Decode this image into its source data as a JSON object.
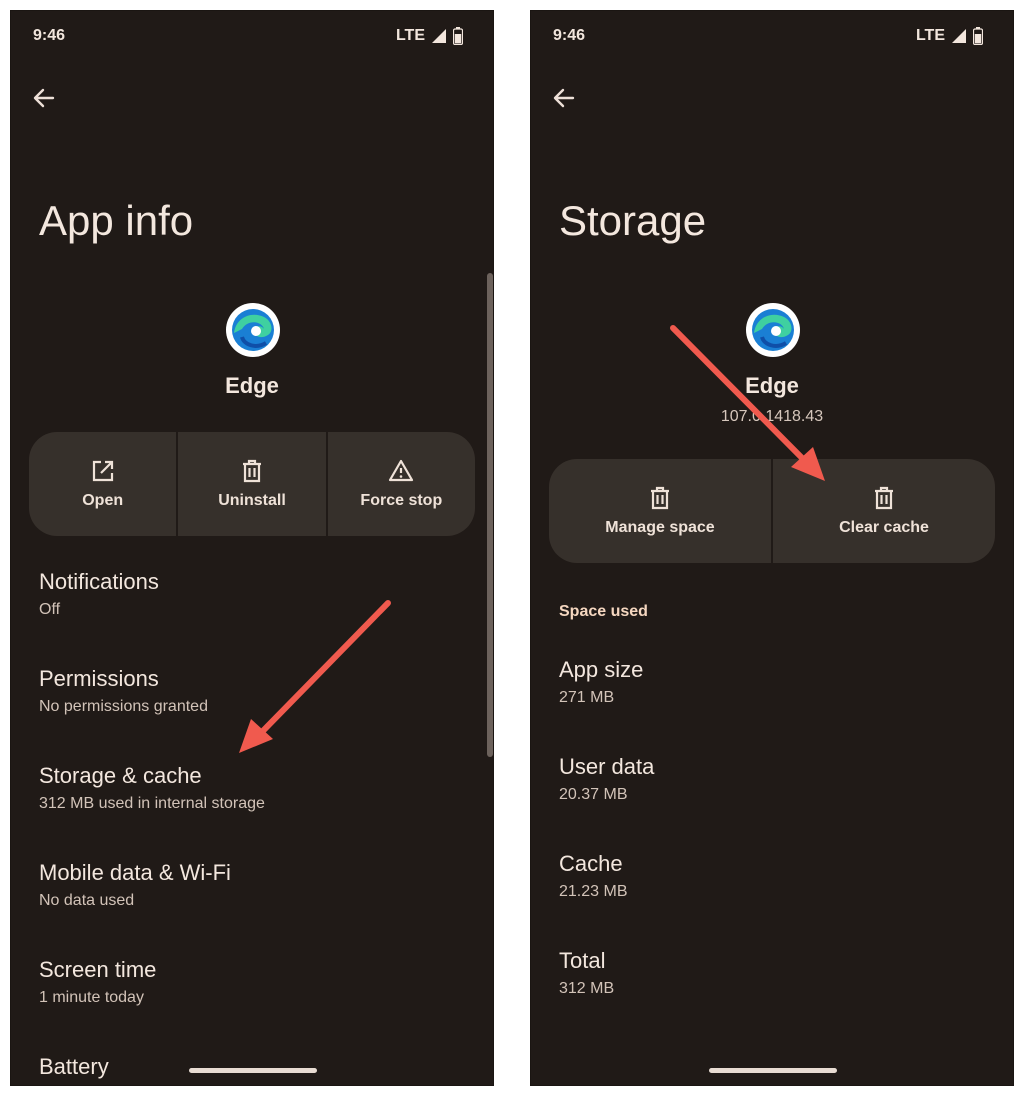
{
  "left_screen": {
    "status": {
      "time": "9:46",
      "network": "LTE"
    },
    "title": "App info",
    "app_name": "Edge",
    "actions": [
      {
        "label": "Open",
        "icon": "open-external-icon"
      },
      {
        "label": "Uninstall",
        "icon": "trash-icon"
      },
      {
        "label": "Force stop",
        "icon": "warning-icon"
      }
    ],
    "items": [
      {
        "title": "Notifications",
        "subtitle": "Off"
      },
      {
        "title": "Permissions",
        "subtitle": "No permissions granted"
      },
      {
        "title": "Storage & cache",
        "subtitle": "312 MB used in internal storage"
      },
      {
        "title": "Mobile data & Wi-Fi",
        "subtitle": "No data used"
      },
      {
        "title": "Screen time",
        "subtitle": "1 minute today"
      },
      {
        "title": "Battery",
        "subtitle": ""
      }
    ]
  },
  "right_screen": {
    "status": {
      "time": "9:46",
      "network": "LTE"
    },
    "title": "Storage",
    "app_name": "Edge",
    "app_version": "107.0.1418.43",
    "actions": [
      {
        "label": "Manage space",
        "icon": "trash-icon"
      },
      {
        "label": "Clear cache",
        "icon": "trash-icon"
      }
    ],
    "section_header": "Space used",
    "items": [
      {
        "title": "App size",
        "subtitle": "271 MB"
      },
      {
        "title": "User data",
        "subtitle": "20.37 MB"
      },
      {
        "title": "Cache",
        "subtitle": "21.23 MB"
      },
      {
        "title": "Total",
        "subtitle": "312 MB"
      }
    ]
  },
  "colors": {
    "background": "#201a17",
    "button_bg": "#36302b",
    "text": "#f3e7de",
    "section_accent": "#f5d7c0",
    "annotation_arrow": "#f05a4e"
  }
}
